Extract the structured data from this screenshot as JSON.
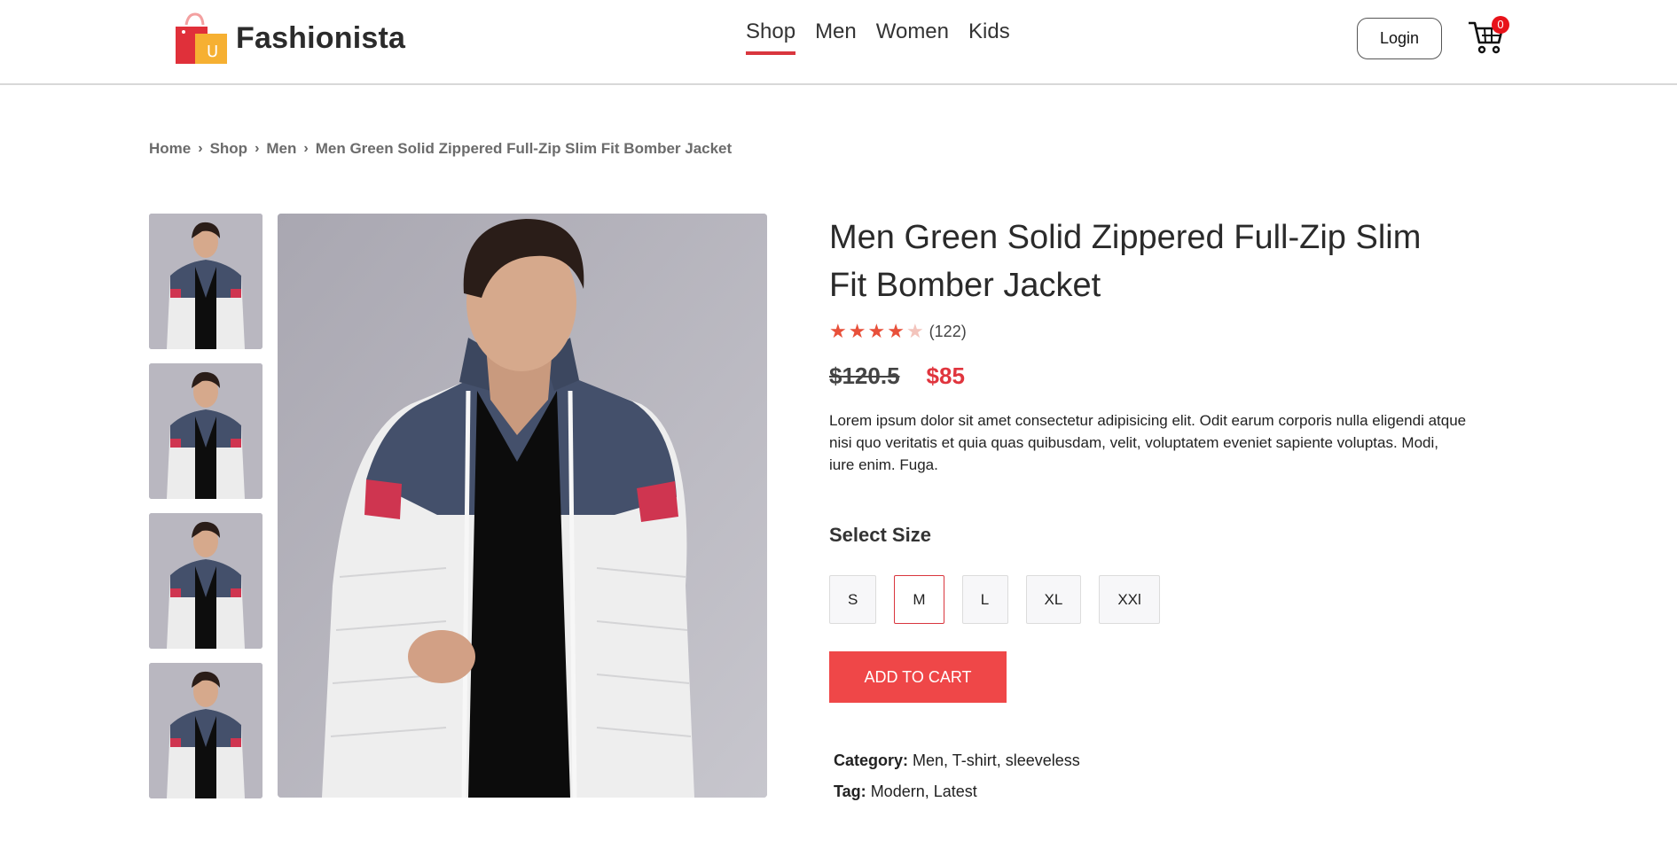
{
  "brand": {
    "name": "Fashionista",
    "logo_letter": "U"
  },
  "nav": {
    "items": [
      "Shop",
      "Men",
      "Women",
      "Kids"
    ],
    "active": "Shop"
  },
  "header": {
    "login_label": "Login",
    "cart_count": "0"
  },
  "breadcrumb": [
    "Home",
    "Shop",
    "Men",
    "Men Green Solid Zippered Full-Zip Slim Fit Bomber Jacket"
  ],
  "product": {
    "title": "Men Green Solid Zippered Full-Zip Slim Fit Bomber Jacket",
    "rating": 4,
    "rating_max": 5,
    "review_count": "(122)",
    "old_price": "$120.5",
    "new_price": "$85",
    "description": "Lorem ipsum dolor sit amet consectetur adipisicing elit. Odit earum corporis nulla eligendi atque nisi quo veritatis et quia quas quibusdam, velit, voluptatem eveniet sapiente voluptas. Modi, iure enim. Fuga.",
    "size_label": "Select Size",
    "sizes": [
      "S",
      "M",
      "L",
      "XL",
      "XXl"
    ],
    "selected_size": "M",
    "add_to_cart_label": "ADD TO CART",
    "category_label": "Category:",
    "category_value": "Men, T-shirt, sleeveless",
    "tag_label": "Tag:",
    "tag_value": "Modern, Latest"
  },
  "colors": {
    "accent": "#ef4748",
    "price": "#e0353e",
    "star": "#e8503a",
    "badge": "#e8121a"
  }
}
